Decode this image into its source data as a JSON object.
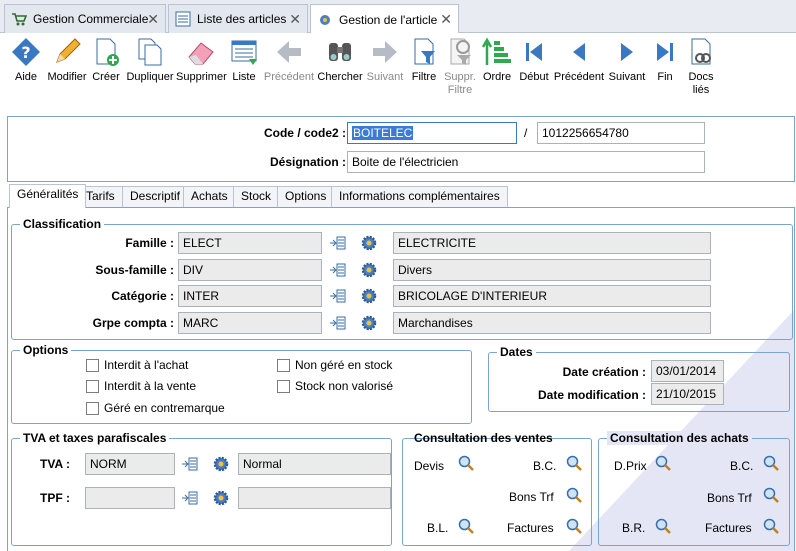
{
  "window_tabs": [
    {
      "label": "Gestion Commerciale",
      "icon": "cart-icon"
    },
    {
      "label": "Liste des articles",
      "icon": "list-icon"
    },
    {
      "label": "Gestion de l'article",
      "icon": "gear-icon"
    }
  ],
  "toolbar": {
    "aide": "Aide",
    "modifier": "Modifier",
    "creer": "Créer",
    "dupliquer": "Dupliquer",
    "supprimer": "Supprimer",
    "liste": "Liste",
    "precedent1": "Précédent",
    "chercher": "Chercher",
    "suivant1": "Suivant",
    "filtre": "Filtre",
    "suppr_filtre_1": "Suppr.",
    "suppr_filtre_2": "Filtre",
    "ordre": "Ordre",
    "debut": "Début",
    "precedent2": "Précédent",
    "suivant2": "Suivant",
    "fin": "Fin",
    "docs_1": "Docs",
    "docs_2": "liés"
  },
  "header": {
    "code_label": "Code / code2 :",
    "code_value": "BOITELEC",
    "slash": "/",
    "code2_value": "1012256654780",
    "designation_label": "Désignation :",
    "designation_value": "Boite de l'électricien"
  },
  "subtabs": [
    "Généralités",
    "Tarifs",
    "Descriptif",
    "Achats",
    "Stock",
    "Options",
    "Informations complémentaires"
  ],
  "classification": {
    "title": "Classification",
    "rows": [
      {
        "label": "Famille :",
        "code": "ELECT",
        "desc": "ELECTRICITE"
      },
      {
        "label": "Sous-famille :",
        "code": "DIV",
        "desc": "Divers"
      },
      {
        "label": "Catégorie :",
        "code": "INTER",
        "desc": "BRICOLAGE D'INTERIEUR"
      },
      {
        "label": "Grpe compta :",
        "code": "MARC",
        "desc": "Marchandises"
      }
    ]
  },
  "options": {
    "title": "Options",
    "interdit_achat": "Interdit à l'achat",
    "interdit_vente": "Interdit à la vente",
    "gere_contremarque": "Géré en contremarque",
    "non_gere_stock": "Non géré en stock",
    "stock_non_valorise": "Stock non valorisé"
  },
  "dates": {
    "title": "Dates",
    "creation_label": "Date création :",
    "creation_value": "03/01/2014",
    "modif_label": "Date modification :",
    "modif_value": "21/10/2015"
  },
  "tva": {
    "title": "TVA et taxes parafiscales",
    "tva_label": "TVA :",
    "tva_code": "NORM",
    "tva_desc": "Normal",
    "tpf_label": "TPF :",
    "tpf_code": "",
    "tpf_desc": ""
  },
  "ventes": {
    "title": "Consultation des ventes",
    "devis": "Devis",
    "bc": "B.C.",
    "bons_trf": "Bons Trf",
    "bl": "B.L.",
    "factures": "Factures"
  },
  "achats": {
    "title": "Consultation des achats",
    "dprix": "D.Prix",
    "bc": "B.C.",
    "bons_trf": "Bons Trf",
    "br": "B.R.",
    "factures": "Factures"
  }
}
